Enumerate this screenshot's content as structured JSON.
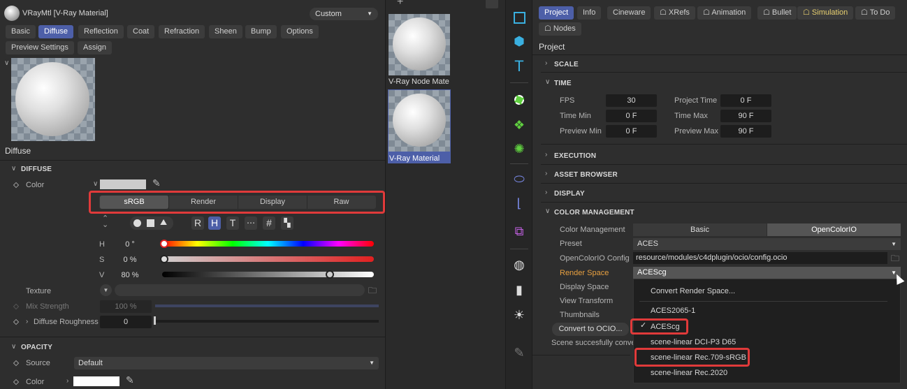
{
  "material": {
    "title": "VRayMtl [V-Ray Material]",
    "preset": "Custom",
    "tabs": [
      "Basic",
      "Diffuse",
      "Reflection",
      "Coat",
      "Refraction",
      "Sheen",
      "Bump",
      "Options"
    ],
    "tabs2": [
      "Preview Settings",
      "Assign"
    ],
    "active_tab": "Diffuse",
    "section_title": "Diffuse",
    "diffuse_header": "DIFFUSE",
    "color_label": "Color",
    "color_modes": [
      "sRGB",
      "Render",
      "Display",
      "Raw"
    ],
    "active_color_mode": "sRGB",
    "picker_modes": [
      "R",
      "H",
      "T"
    ],
    "hsv": {
      "h_label": "H",
      "h_value": "0 °",
      "s_label": "S",
      "s_value": "0 %",
      "v_label": "V",
      "v_value": "80 %"
    },
    "texture_label": "Texture",
    "mix_strength_label": "Mix Strength",
    "mix_strength_value": "100 %",
    "roughness_label": "Diffuse Roughness",
    "roughness_value": "0",
    "opacity_header": "OPACITY",
    "source_label": "Source",
    "source_value": "Default",
    "opacity_color_label": "Color"
  },
  "browser": {
    "items": [
      "V-Ray Node Mate",
      "V-Ray Material"
    ],
    "selected": "V-Ray Material"
  },
  "project": {
    "tabs_row1": [
      "Project",
      "Info",
      "Cineware",
      "XRefs",
      "Animation",
      "Bullet",
      "Simulation",
      "To Do"
    ],
    "tabs_row2": [
      "Nodes"
    ],
    "active_tab": "Project",
    "heading": "Project",
    "sections": {
      "scale": "SCALE",
      "time": "TIME",
      "execution": "EXECUTION",
      "asset_browser": "ASSET BROWSER",
      "display": "DISPLAY",
      "color_management": "COLOR MANAGEMENT"
    },
    "time": {
      "fps_label": "FPS",
      "fps": "30",
      "project_time_label": "Project Time",
      "project_time": "0 F",
      "time_min_label": "Time Min",
      "time_min": "0 F",
      "time_max_label": "Time Max",
      "time_max": "90 F",
      "preview_min_label": "Preview Min",
      "preview_min": "0 F",
      "preview_max_label": "Preview Max",
      "preview_max": "90 F"
    },
    "cm": {
      "mode_label": "Color Management",
      "modes": [
        "Basic",
        "OpenColorIO"
      ],
      "active_mode": "OpenColorIO",
      "preset_label": "Preset",
      "preset": "ACES",
      "config_label": "OpenColorIO Config",
      "config": "resource/modules/c4dplugin/ocio/config.ocio",
      "render_space_label": "Render Space",
      "render_space": "ACEScg",
      "display_space_label": "Display Space",
      "view_transform_label": "View Transform",
      "thumbnails_label": "Thumbnails",
      "convert_button": "Convert to OCIO...",
      "status": "Scene succesfully conve"
    },
    "dropdown": {
      "items": [
        "Convert Render Space...",
        "ACES2065-1",
        "ACEScg",
        "scene-linear DCI-P3 D65",
        "scene-linear Rec.709-sRGB",
        "scene-linear Rec.2020"
      ],
      "checked": "ACEScg"
    }
  },
  "colors": {
    "accent": "#4d5fa8",
    "highlight_box": "#e03a3a",
    "render_space_label": "#e8a040"
  }
}
